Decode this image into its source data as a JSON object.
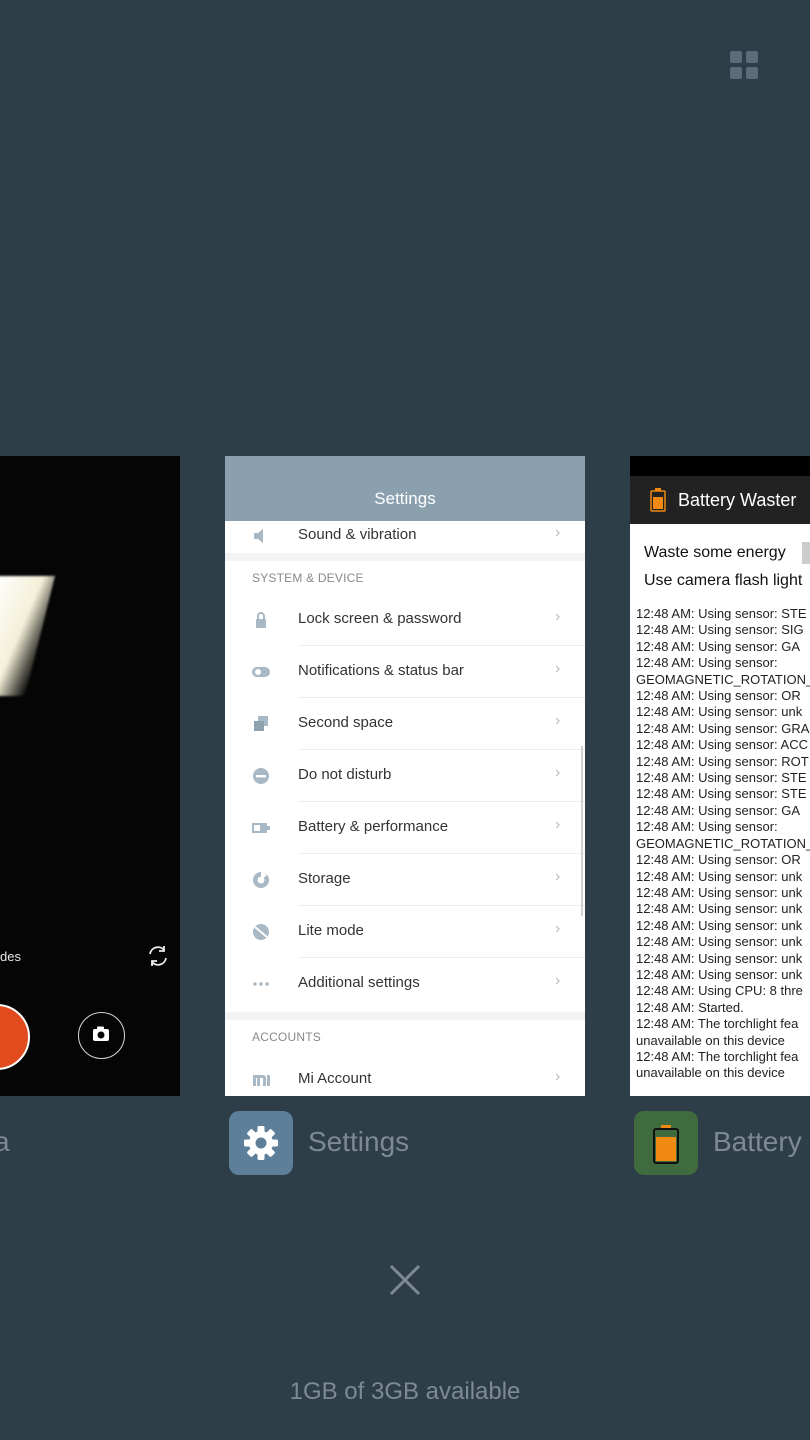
{
  "camera": {
    "modes_text": "des",
    "app_label": "a"
  },
  "settings": {
    "title": "Settings",
    "app_label": "Settings",
    "rows_top": [
      {
        "label": "Sound & vibration",
        "icon": "speaker-icon"
      }
    ],
    "section_system": "SYSTEM & DEVICE",
    "rows": [
      {
        "label": "Lock screen & password",
        "icon": "lock-icon"
      },
      {
        "label": "Notifications & status bar",
        "icon": "toggle-icon"
      },
      {
        "label": "Second space",
        "icon": "second-space-icon"
      },
      {
        "label": "Do not disturb",
        "icon": "do-not-disturb-icon"
      },
      {
        "label": "Battery & performance",
        "icon": "battery-icon"
      },
      {
        "label": "Storage",
        "icon": "storage-icon"
      },
      {
        "label": "Lite mode",
        "icon": "lite-mode-icon"
      },
      {
        "label": "Additional settings",
        "icon": "more-dots-icon"
      }
    ],
    "section_accounts": "ACCOUNTS",
    "rows_accounts": [
      {
        "label": "Mi Account",
        "icon": "mi-icon"
      }
    ]
  },
  "battery_waster": {
    "title": "Battery Waster",
    "app_label": "Battery",
    "options": [
      "Waste some energy",
      "Use camera flash light"
    ],
    "log": [
      "12:48 AM: Using sensor: STE",
      "12:48 AM: Using sensor: SIG",
      "12:48 AM: Using sensor: GA",
      "12:48 AM: Using sensor:",
      "GEOMAGNETIC_ROTATION_",
      "12:48 AM: Using sensor: OR",
      "12:48 AM: Using sensor: unk",
      "12:48 AM: Using sensor: GRA",
      "12:48 AM: Using sensor: ACC",
      "12:48 AM: Using sensor: ROT",
      "12:48 AM: Using sensor: STE",
      "12:48 AM: Using sensor: STE",
      "12:48 AM: Using sensor: GA",
      "12:48 AM: Using sensor:",
      "GEOMAGNETIC_ROTATION_",
      "12:48 AM: Using sensor: OR",
      "12:48 AM: Using sensor: unk",
      "12:48 AM: Using sensor: unk",
      "12:48 AM: Using sensor: unk",
      "12:48 AM: Using sensor: unk",
      "12:48 AM: Using sensor: unk",
      "12:48 AM: Using sensor: unk",
      "12:48 AM: Using sensor: unk",
      "12:48 AM: Using CPU: 8 thre",
      "12:48 AM: Started.",
      "12:48 AM: The torchlight fea",
      "unavailable on this device",
      "12:48 AM: The torchlight fea",
      "unavailable on this device"
    ]
  },
  "footer": {
    "memory": "1GB of 3GB available"
  },
  "colors": {
    "background": "#2d3e48",
    "settings_header": "#8ba0ae",
    "shutter": "#e24b1e",
    "battery_icon": "#f08a12"
  }
}
